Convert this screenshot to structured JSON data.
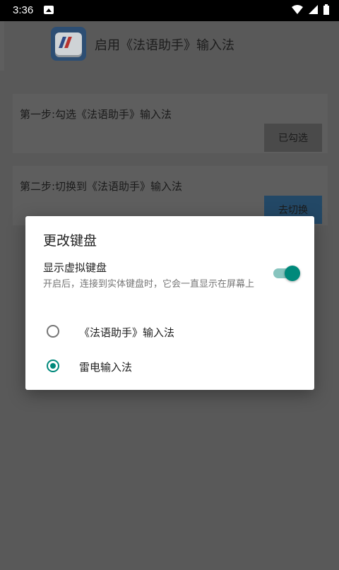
{
  "status_bar": {
    "time": "3:36",
    "icons": [
      "image-icon",
      "wifi-icon",
      "cell-signal-icon",
      "battery-icon"
    ]
  },
  "app": {
    "title": "启用《法语助手》输入法",
    "steps": [
      {
        "label": "第一步:勾选《法语助手》输入法",
        "button": "已勾选"
      },
      {
        "label": "第二步:切换到《法语助手》输入法",
        "button": "去切换"
      }
    ]
  },
  "dialog": {
    "title": "更改键盘",
    "switch": {
      "label": "显示虚拟键盘",
      "description": "开启后，连接到实体键盘时，它会一直显示在屏幕上",
      "enabled": true
    },
    "options": [
      {
        "label": "《法语助手》输入法",
        "selected": false
      },
      {
        "label": "雷电输入法",
        "selected": true
      }
    ]
  },
  "colors": {
    "accent": "#00897b",
    "scrim": "#535353",
    "dialog_bg": "#ffffff"
  }
}
